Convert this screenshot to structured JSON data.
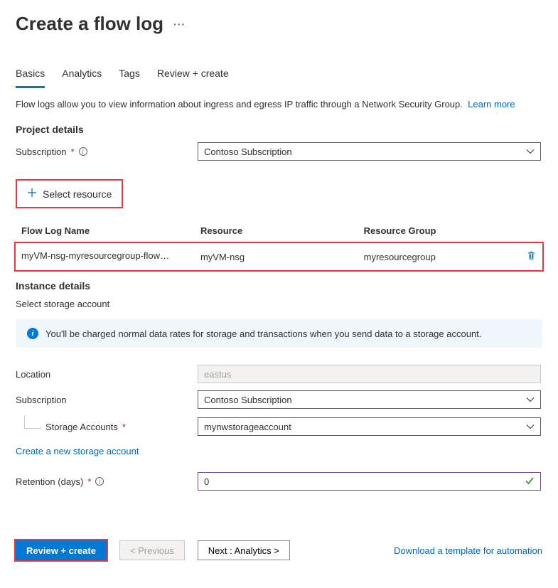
{
  "header": {
    "title": "Create a flow log"
  },
  "tabs": [
    "Basics",
    "Analytics",
    "Tags",
    "Review + create"
  ],
  "activeTab": 0,
  "description": {
    "text": "Flow logs allow you to view information about ingress and egress IP traffic through a Network Security Group.",
    "learnMore": "Learn more"
  },
  "projectDetails": {
    "title": "Project details",
    "subscriptionLabel": "Subscription",
    "subscriptionValue": "Contoso Subscription",
    "selectResource": "Select resource"
  },
  "resourceTable": {
    "headers": [
      "Flow Log Name",
      "Resource",
      "Resource Group"
    ],
    "row": {
      "flowLogName": "myVM-nsg-myresourcegroup-flowl…",
      "resource": "myVM-nsg",
      "resourceGroup": "myresourcegroup"
    }
  },
  "instanceDetails": {
    "title": "Instance details",
    "selectStorage": "Select storage account",
    "bannerText": "You'll be charged normal data rates for storage and transactions when you send data to a storage account.",
    "locationLabel": "Location",
    "locationValue": "eastus",
    "subscriptionLabel": "Subscription",
    "subscriptionValue": "Contoso Subscription",
    "storageLabel": "Storage Accounts",
    "storageValue": "mynwstorageaccount",
    "createStorageLink": "Create a new storage account",
    "retentionLabel": "Retention (days)",
    "retentionValue": "0"
  },
  "footer": {
    "reviewCreate": "Review + create",
    "previous": "< Previous",
    "next": "Next : Analytics >",
    "downloadTemplate": "Download a template for automation"
  }
}
